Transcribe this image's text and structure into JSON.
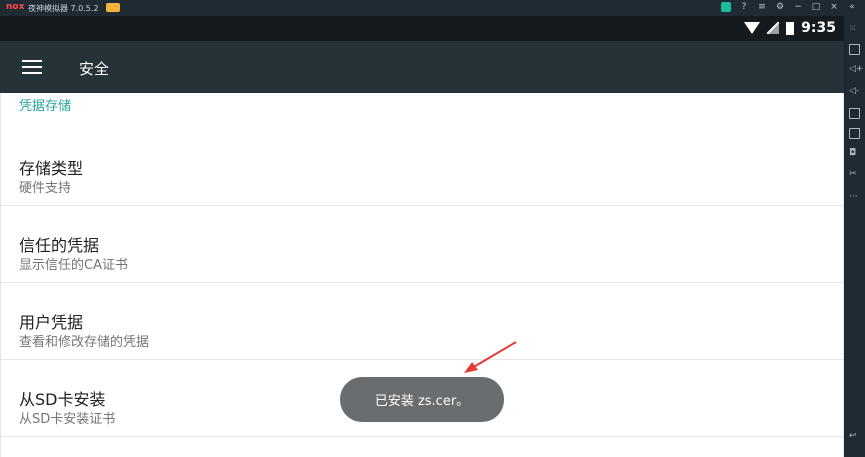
{
  "emulator": {
    "logo": "nox",
    "title": "夜神模拟器 7.0.5.2"
  },
  "status_bar": {
    "time": "9:35"
  },
  "app_bar": {
    "title": "安全"
  },
  "section": {
    "header": "凭据存储"
  },
  "preferences": [
    {
      "title": "存储类型",
      "summary": "硬件支持"
    },
    {
      "title": "信任的凭据",
      "summary": "显示信任的CA证书"
    },
    {
      "title": "用户凭据",
      "summary": "查看和修改存储的凭据"
    },
    {
      "title": "从SD卡安装",
      "summary": "从SD卡安装证书"
    }
  ],
  "toast": {
    "message": "已安装 zs.cer。"
  },
  "colors": {
    "app_bar": "#263238",
    "status_bar": "#141a1e",
    "accent": "#26a69a",
    "toast": "#6a6d70",
    "arrow": "#e53935"
  }
}
